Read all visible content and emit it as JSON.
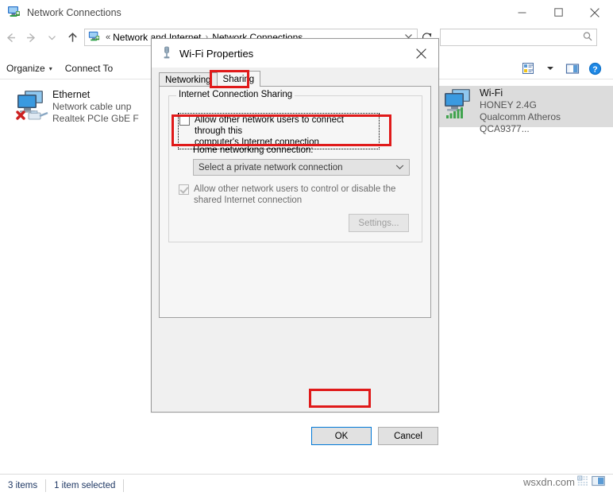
{
  "window": {
    "title": "Network Connections",
    "icon": "network-connections-icon",
    "controls": {
      "minimize": "—",
      "maximize": "☐",
      "close": "✕"
    }
  },
  "address_bar": {
    "back": "←",
    "forward": "→",
    "recent": "∨",
    "up": "↑",
    "overflow": "«",
    "crumbs": [
      "Network and Internet",
      "Network Connections"
    ],
    "separator": "›",
    "dropdown": "∨",
    "refresh": "↻"
  },
  "search": {
    "value": "",
    "placeholder": "",
    "icon": "search-icon"
  },
  "toolbar": {
    "organize": "Organize",
    "organize_caret": "▾",
    "connect_to": "Connect To",
    "view_options_icon": "view-options-icon",
    "view_caret": "▾",
    "preview_pane_icon": "preview-pane-icon",
    "help_icon": "help-icon",
    "help_glyph": "?"
  },
  "connections": [
    {
      "name": "Ethernet",
      "status": "Network cable unp",
      "device": "Realtek PCIe GbE F",
      "icon": "ethernet-adapter-icon",
      "selected": false
    },
    {
      "name": "Wi-Fi",
      "status": "HONEY 2.4G",
      "device": "Qualcomm Atheros QCA9377...",
      "icon": "wifi-adapter-icon",
      "selected": true
    }
  ],
  "status_bar": {
    "items_count": "3 items",
    "selection": "1 item selected",
    "watermark": "wsxdn.com"
  },
  "dialog": {
    "title": "Wi-Fi Properties",
    "icon": "network-adapter-icon",
    "close": "✕",
    "tabs": [
      {
        "label": "Networking",
        "selected": false
      },
      {
        "label": "Sharing",
        "selected": true
      }
    ],
    "group_title": "Internet Connection Sharing",
    "allow_connect": {
      "label_line1": "Allow other network users to connect through this",
      "label_line2": "computer's Internet connection",
      "checked": false,
      "focused": true
    },
    "home_networking_label": "Home networking connection:",
    "home_networking_value": "Select a private network connection",
    "combo_arrow": "∨",
    "allow_control": {
      "label_line1": "Allow other network users to control or disable the",
      "label_line2": "shared Internet connection",
      "checked": true,
      "disabled": true
    },
    "settings_button": "Settings...",
    "ok_button": "OK",
    "cancel_button": "Cancel"
  },
  "annotations": {
    "accent_red": "#e01a1a",
    "focus_blue": "#0078d7"
  }
}
